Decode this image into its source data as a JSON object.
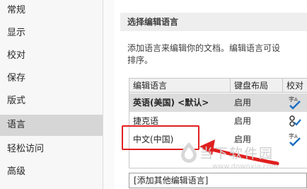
{
  "sidebar": {
    "items": [
      {
        "label": "常规"
      },
      {
        "label": "显示"
      },
      {
        "label": "校对"
      },
      {
        "label": "保存"
      },
      {
        "label": "版式"
      },
      {
        "label": "语言",
        "selected": true
      },
      {
        "label": "轻松访问"
      },
      {
        "label": "高级"
      }
    ]
  },
  "section": {
    "title": "选择编辑语言",
    "description_line1": "添加语言来编辑你的文档。编辑语言可设",
    "description_line2": "排序。"
  },
  "table": {
    "headers": [
      "编辑语言",
      "键盘布局",
      "校对"
    ],
    "rows": [
      {
        "language": "英语(美国) <默认>",
        "keyboard": "启用",
        "proofing": "check-icon"
      },
      {
        "language": "捷克语",
        "keyboard": "启用",
        "proofing": "check-icon"
      },
      {
        "language": "中文(中国)",
        "keyboard": "启用",
        "proofing": "check-icon"
      }
    ]
  },
  "add_language": {
    "label": "[添加其他编辑语言]"
  },
  "watermark": {
    "text": "当下软件园",
    "url": "www.downxia.com"
  },
  "colors": {
    "highlight": "#e02020",
    "selected_nav": "#d6d6d6"
  }
}
